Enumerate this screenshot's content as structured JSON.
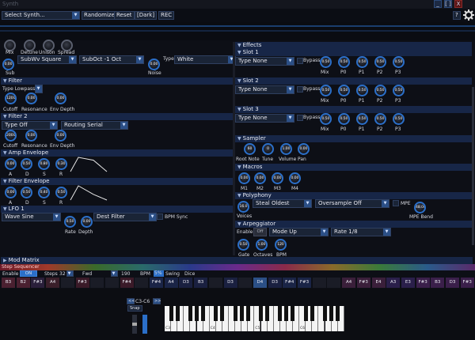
{
  "window": {
    "title": "Synth",
    "min_label": "_",
    "max_label": "[ ]",
    "close_label": "X"
  },
  "toolbar": {
    "preset_select": "Select Synth...",
    "randomize_label": "Randomize",
    "reset_label": "Reset",
    "theme_label": "[Dark]",
    "rec_label": "REC",
    "help_label": "?"
  },
  "osc": {
    "labels": {
      "mix": "Mix",
      "detune": "Detune",
      "unison": "Unison",
      "spread": "Spread",
      "sub": "Sub",
      "noise": "Noise"
    },
    "sub_wave": "SubWv Square",
    "sub_oct": "SubOct -1 Oct",
    "type_label": "Type",
    "type_value": "White",
    "sub_value": "0.00",
    "noise_value": "0.00"
  },
  "filter": {
    "title": "Filter",
    "type": "Type Lowpass",
    "cutoff": "1200",
    "resonance": "0.00",
    "env_depth": "0.00",
    "labels": {
      "cutoff": "Cutoff",
      "resonance": "Resonance",
      "env_depth": "Env Depth"
    }
  },
  "filter2": {
    "title": "Filter 2",
    "type": "Type Off",
    "routing": "Routing Serial",
    "cutoff": "2000",
    "resonance": "0.00",
    "env_depth": "0.00",
    "labels": {
      "cutoff": "Cutoff",
      "resonance": "Resonance",
      "env_depth": "Env Depth"
    }
  },
  "amp_env": {
    "title": "Amp Envelope",
    "a": "0.00",
    "d": "0.50",
    "s": "0.80",
    "r": "0.30",
    "labels": {
      "a": "A",
      "d": "D",
      "s": "S",
      "r": "R"
    },
    "curve": [
      0,
      1,
      0.8,
      0
    ]
  },
  "filter_env": {
    "title": "Filter Envelope",
    "a": "0.00",
    "d": "0.50",
    "s": "0.40",
    "r": "0.50",
    "labels": {
      "a": "A",
      "d": "D",
      "s": "S",
      "r": "R"
    },
    "curve": [
      0,
      1,
      0.4,
      0
    ]
  },
  "lfo": {
    "title": "LFO 1",
    "wave": "Wave Sine",
    "dest": "Dest Filter",
    "bpm_sync": "BPM Sync",
    "rate": "0.50",
    "depth": "0.00",
    "labels": {
      "rate": "Rate",
      "depth": "Depth"
    }
  },
  "mod_matrix": {
    "title": "Mod Matrix"
  },
  "step_seq": {
    "title": "Step Sequencer",
    "enable_label": "Enable",
    "enable_value": "ON",
    "steps_label": "Steps",
    "steps_value": "32",
    "direction": "Fwd",
    "bpm_value": "190",
    "bpm_label": "BPM",
    "swing_value": "5%",
    "swing_label": "Swing",
    "dice_label": "Dice",
    "steps": [
      "B3",
      "B2",
      "F#3",
      "A4",
      "",
      "F#3",
      "",
      "",
      "F#4",
      "",
      "F#4",
      "A4",
      "D3",
      "B3",
      "",
      "D3",
      "",
      "D4",
      "D3",
      "F#4",
      "F#3",
      "",
      "",
      "A4",
      "F#3",
      "E4",
      "A3",
      "E3",
      "F#3",
      "B3",
      "D3",
      "F#3"
    ]
  },
  "keyboard": {
    "range_label": "C3-C6",
    "prev_label": "<<",
    "next_label": ">>",
    "snap_label": "Snap",
    "octaves": [
      "C3",
      "C4",
      "C5",
      "C6"
    ]
  },
  "effects": {
    "title": "Effects",
    "knob_labels": [
      "Mix",
      "P0",
      "P1",
      "P2",
      "P3"
    ],
    "slots": [
      {
        "title": "Slot 1",
        "type": "Type None",
        "bypass": "Bypass",
        "values": [
          "0.50",
          "0.50",
          "0.50",
          "0.50",
          "0.50"
        ]
      },
      {
        "title": "Slot 2",
        "type": "Type None",
        "bypass": "Bypass",
        "values": [
          "0.50",
          "0.50",
          "0.50",
          "0.50",
          "0.50"
        ]
      },
      {
        "title": "Slot 3",
        "type": "Type None",
        "bypass": "Bypass",
        "values": [
          "0.50",
          "0.50",
          "0.50",
          "0.50",
          "0.50"
        ]
      }
    ]
  },
  "sampler": {
    "title": "Sampler",
    "values": [
      "60",
      "0",
      "1.00",
      "0.00"
    ],
    "labels": [
      "Root Note",
      "Tune",
      "Volume",
      "Pan"
    ]
  },
  "macros": {
    "title": "Macros",
    "values": [
      "0.00",
      "0.00",
      "0.00",
      "0.00"
    ],
    "labels": [
      "M1",
      "M2",
      "M3",
      "M4"
    ]
  },
  "polyphony": {
    "title": "Polyphony",
    "voices_value": "16.0",
    "voices_label": "Voices",
    "steal": "Steal Oldest",
    "oversample": "Oversample Off",
    "mpe": "MPE",
    "mpe_bend_value": "48.00",
    "mpe_bend_label": "MPE Bend"
  },
  "arp": {
    "title": "Arpeggiator",
    "enable_label": "Enable",
    "enable_value": "Off",
    "mode": "Mode Up",
    "rate": "Rate 1/8",
    "gate_value": "0.50",
    "octaves_value": "1.00",
    "bpm_value": "120",
    "labels": {
      "gate": "Gate",
      "octaves": "Octaves",
      "bpm": "BPM"
    }
  },
  "colors": {
    "accent": "#2b6fc9",
    "header": "#172647",
    "background": "#0d0f16"
  }
}
